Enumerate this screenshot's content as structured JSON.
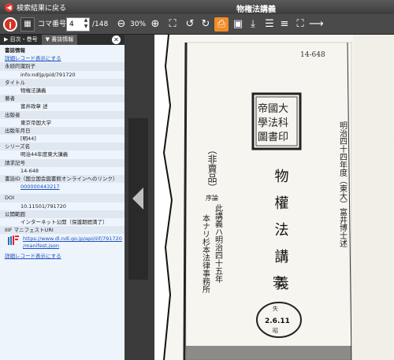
{
  "topbar": {
    "back_label": "検索結果に戻る",
    "title": "物権法講義"
  },
  "toolbar": {
    "koma_label": "コマ番号",
    "koma_value": "4",
    "koma_total": "/148",
    "zoom": "30%"
  },
  "sidebar": {
    "tab_toc": "目次・巻号",
    "tab_info": "書誌情報",
    "section_title": "書誌情報",
    "top_link": "詳細レコード表示にする",
    "fields": [
      {
        "label": "永続的識別子",
        "value": "info:ndljp/pid/791720"
      },
      {
        "label": "タイトル",
        "value": "物権法講義"
      },
      {
        "label": "著者",
        "value": "富井政章 述"
      },
      {
        "label": "出版者",
        "value": "東京帝国大学"
      },
      {
        "label": "出版年月日",
        "value": "[明44]"
      },
      {
        "label": "シリーズ名",
        "value": "明治44年度東大講義"
      },
      {
        "label": "請求記号",
        "value": "14-648"
      }
    ],
    "bookid_label": "書誌ID（国立国会図書館オンラインへのリンク）",
    "bookid_value": "000000443217",
    "doi_label": "DOI",
    "doi_value": "10.11501/791720",
    "access_label": "公開範囲",
    "access_value": "インターネット公開（保護期間満了）",
    "iiif_label": "IIIF マニフェストURI",
    "iiif_url_1": "https://www.dl.ndl.go.jp/api/iiif/791720",
    "iiif_url_2": "/manifest.json",
    "bottom_link": "詳細レコード表示にする"
  },
  "document": {
    "top_note": "14-648",
    "seal_chars": "帝國大學法科大學圖書",
    "hibaihin": "（非賣品）",
    "title_vertical": "物權法講義",
    "right_col": "明治四十四年度（東大）富井博士述",
    "kan": "完",
    "date_stamp": "2.6.11",
    "intro_head": "序論",
    "intro_text1": "此講義ハ明治四十五年",
    "intro_text2": "本ナリ杉本法律事務所",
    "stamp_top": "失",
    "stamp_bottom": "昭"
  }
}
